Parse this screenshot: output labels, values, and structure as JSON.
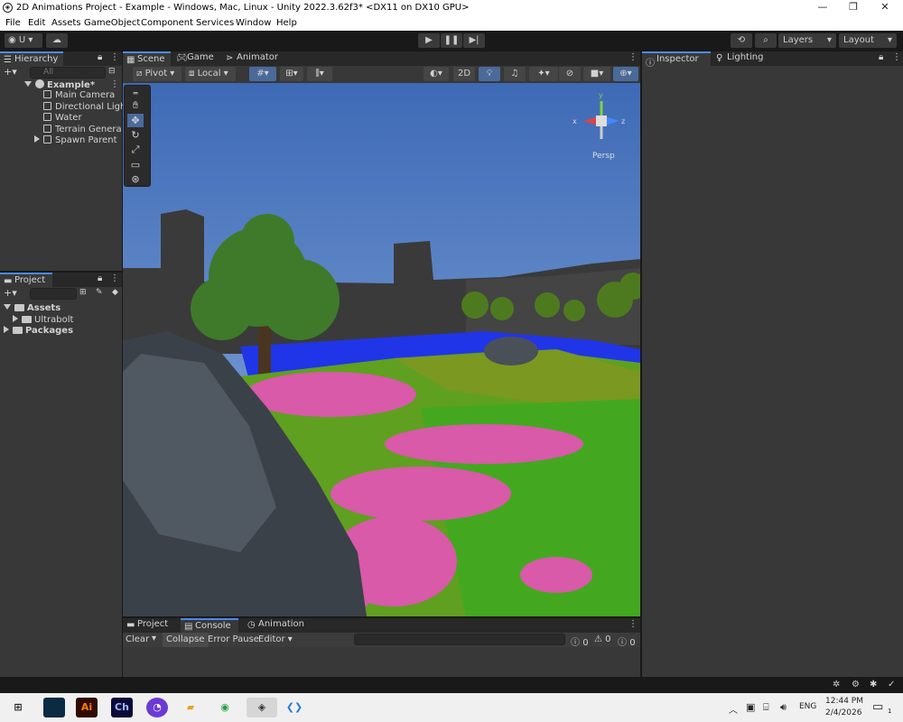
{
  "window": {
    "title": "2D Animations Project - Example - Windows, Mac, Linux - Unity 2022.3.62f3* <DX11 on DX10 GPU>",
    "controls": [
      "—",
      "❐",
      "✕"
    ]
  },
  "menu": [
    "File",
    "Edit",
    "Assets",
    "GameObject",
    "Component",
    "Services",
    "Window",
    "Help"
  ],
  "toolbar": {
    "account": "U",
    "play_icons": [
      "play-icon",
      "pause-icon",
      "step-icon"
    ],
    "layers": "Layers",
    "layout": "Layout"
  },
  "hierarchy": {
    "tab": "Hierarchy",
    "search_placeholder": "All",
    "scene": "Example*",
    "items": [
      "Main Camera",
      "Directional Light",
      "Water",
      "Terrain Generato",
      "Spawn Parent"
    ]
  },
  "project": {
    "tab": "Project",
    "items": [
      {
        "label": "Assets",
        "level": 0
      },
      {
        "label": "Ultrabolt",
        "level": 1
      },
      {
        "label": "Packages",
        "level": 0
      }
    ]
  },
  "scene_tabs": [
    "Scene",
    "Game",
    "Animator"
  ],
  "scene_toolbar": {
    "pivot": "Pivot",
    "local": "Local",
    "mode_2d": "2D",
    "persp": "Persp",
    "axes": [
      "y",
      "x",
      "z"
    ]
  },
  "bottom": {
    "tabs": [
      "Project",
      "Console",
      "Animation"
    ],
    "clear": "Clear",
    "collapse": "Collapse",
    "error_pause": "Error Pause",
    "editor": "Editor",
    "counts": [
      "0",
      "0",
      "0"
    ]
  },
  "inspector": {
    "tabs": [
      "Inspector",
      "Lighting"
    ]
  },
  "taskbar": {
    "apps": [
      "Ai",
      "Ch"
    ],
    "lang": "ENG",
    "time": "12:44 PM",
    "date": "2/4/2026",
    "notif_count": "1"
  },
  "colors": {
    "accent": "#4d8af0",
    "panel": "#383838",
    "dark": "#191919"
  }
}
